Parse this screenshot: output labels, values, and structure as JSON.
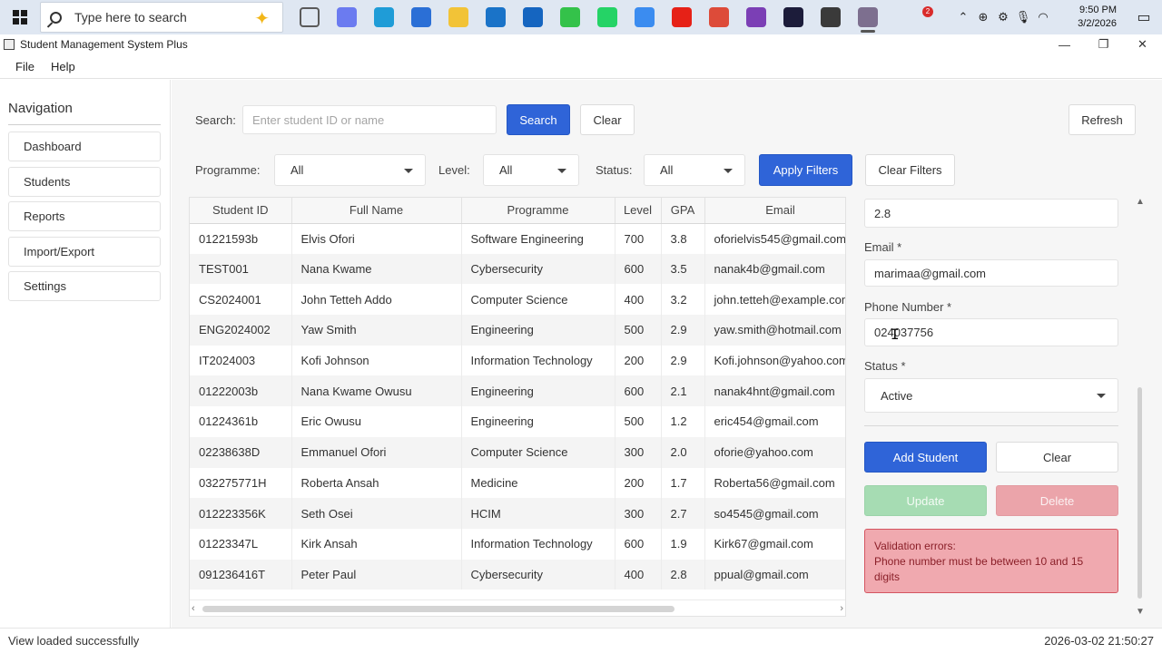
{
  "taskbar": {
    "search_placeholder": "Type here to search",
    "notification_count": "2",
    "time": "9:50 PM",
    "date": "3/2/2026",
    "apps": [
      {
        "name": "task-view-icon",
        "color": "#5a5a5a"
      },
      {
        "name": "copilot-icon",
        "color": "#6b7bf0"
      },
      {
        "name": "edge-icon",
        "color": "#1f9cd7"
      },
      {
        "name": "microsoft-store-icon",
        "color": "#2b6fd6"
      },
      {
        "name": "file-explorer-icon",
        "color": "#f2c337"
      },
      {
        "name": "outlook-icon",
        "color": "#1a73c8"
      },
      {
        "name": "powershell-icon",
        "color": "#1565c0"
      },
      {
        "name": "ai-app-icon",
        "color": "#34c24a"
      },
      {
        "name": "whatsapp-icon",
        "color": "#25d366"
      },
      {
        "name": "photos-icon",
        "color": "#3b8cf0"
      },
      {
        "name": "youtube-icon",
        "color": "#e62117"
      },
      {
        "name": "chrome-icon",
        "color": "#dd4b39"
      },
      {
        "name": "github-desktop-icon",
        "color": "#7b3fb5"
      },
      {
        "name": "intellij-icon",
        "color": "#1c1c3a"
      },
      {
        "name": "recorder-icon",
        "color": "#3a3a3a"
      },
      {
        "name": "snipping-tool-icon",
        "color": "#7d6f8f"
      }
    ]
  },
  "window": {
    "title": "Student Management System Plus",
    "minimize": "—",
    "restore": "❐",
    "close": "✕"
  },
  "menu": [
    "File",
    "Help"
  ],
  "sidebar": {
    "title": "Navigation",
    "items": [
      "Dashboard",
      "Students",
      "Reports",
      "Import/Export",
      "Settings"
    ]
  },
  "search": {
    "label": "Search:",
    "placeholder": "Enter student ID or name",
    "search_button": "Search",
    "clear_button": "Clear",
    "refresh_button": "Refresh"
  },
  "filters": {
    "programme_label": "Programme:",
    "programme_value": "All",
    "level_label": "Level:",
    "level_value": "All",
    "status_label": "Status:",
    "status_value": "All",
    "apply_button": "Apply Filters",
    "clear_button": "Clear Filters"
  },
  "table": {
    "columns": [
      "Student ID",
      "Full Name",
      "Programme",
      "Level",
      "GPA",
      "Email"
    ],
    "rows": [
      [
        "01221593b",
        "Elvis Ofori",
        "Software Engineering",
        "700",
        "3.8",
        "oforielvis545@gmail.com"
      ],
      [
        "TEST001",
        "Nana Kwame",
        "Cybersecurity",
        "600",
        "3.5",
        "nanak4b@gmail.com"
      ],
      [
        "CS2024001",
        "John Tetteh Addo",
        "Computer Science",
        "400",
        "3.2",
        "john.tetteh@example.com"
      ],
      [
        "ENG2024002",
        "Yaw Smith",
        "Engineering",
        "500",
        "2.9",
        "yaw.smith@hotmail.com"
      ],
      [
        "IT2024003",
        "Kofi Johnson",
        "Information Technology",
        "200",
        "2.9",
        "Kofi.johnson@yahoo.com"
      ],
      [
        "01222003b",
        "Nana Kwame Owusu",
        "Engineering",
        "600",
        "2.1",
        "nanak4hnt@gmail.com"
      ],
      [
        "01224361b",
        "Eric Owusu",
        "Engineering",
        "500",
        "1.2",
        "eric454@gmail.com"
      ],
      [
        "02238638D",
        "Emmanuel Ofori",
        "Computer Science",
        "300",
        "2.0",
        "oforie@yahoo.com"
      ],
      [
        "032275771H",
        "Roberta Ansah",
        "Medicine",
        "200",
        "1.7",
        "Roberta56@gmail.com"
      ],
      [
        "012223356K",
        "Seth Osei",
        "HCIM",
        "300",
        "2.7",
        "so4545@gmail.com"
      ],
      [
        "01223347L",
        "Kirk Ansah",
        "Information Technology",
        "600",
        "1.9",
        "Kirk67@gmail.com"
      ],
      [
        "091236416T",
        "Peter Paul",
        "Cybersecurity",
        "400",
        "2.8",
        "ppual@gmail.com"
      ]
    ]
  },
  "form": {
    "gpa_value": "2.8",
    "email_label": "Email *",
    "email_value": "marimaa@gmail.com",
    "phone_label": "Phone Number *",
    "phone_value": "024037756",
    "status_label": "Status *",
    "status_value": "Active",
    "add_button": "Add Student",
    "clear_button": "Clear",
    "update_button": "Update",
    "delete_button": "Delete",
    "error_title": "Validation errors:",
    "error_message": "Phone number must be between 10 and 15 digits"
  },
  "status": {
    "message": "View loaded successfully",
    "timestamp": "2026-03-02 21:50:27"
  },
  "colors": {
    "primary": "#2f64d8",
    "error_bg": "#f0a9af",
    "update_disabled": "#a6dcb3",
    "delete_disabled": "#eba4aa"
  }
}
